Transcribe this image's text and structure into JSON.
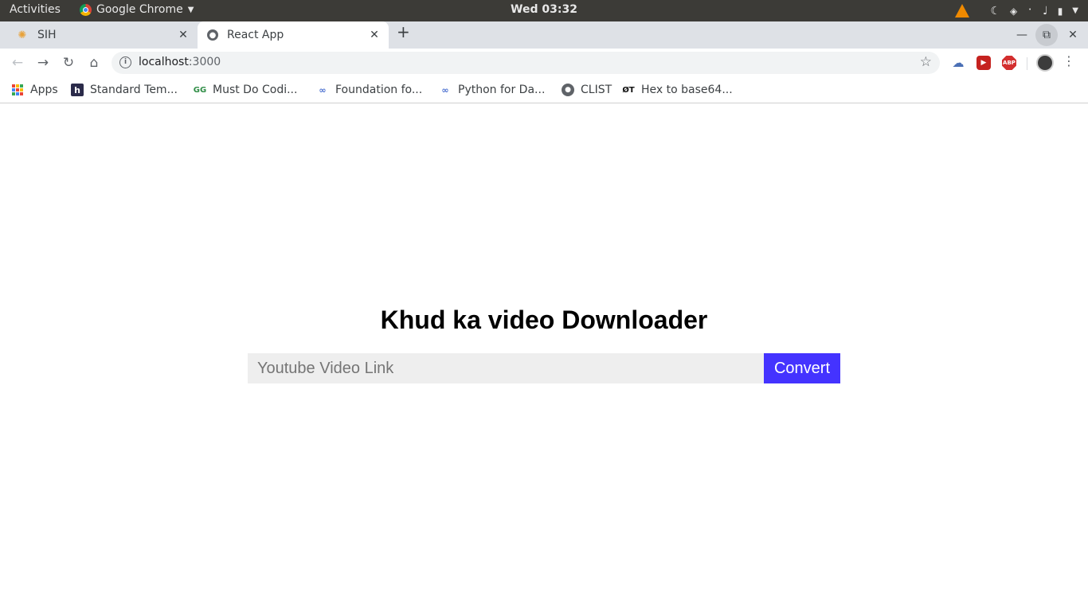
{
  "system_bar": {
    "activities": "Activities",
    "app_name": "Google Chrome",
    "clock": "Wed 03:32"
  },
  "tabs": [
    {
      "label": "SIH",
      "active": false
    },
    {
      "label": "React App",
      "active": true
    }
  ],
  "toolbar": {
    "url_host": "localhost",
    "url_port": ":3000"
  },
  "bookmarks": [
    {
      "label": "Apps",
      "icon": "apps-grid-icon"
    },
    {
      "label": "Standard Tem...",
      "icon": "h-icon"
    },
    {
      "label": "Must Do Codi...",
      "icon": "gfg-icon"
    },
    {
      "label": "Foundation fo...",
      "icon": "link-icon"
    },
    {
      "label": "Python for Da...",
      "icon": "link-icon"
    },
    {
      "label": "CLIST",
      "icon": "globe-icon"
    },
    {
      "label": "Hex to base64...",
      "icon": "ot-icon"
    }
  ],
  "page": {
    "heading": "Khud ka video Downloader",
    "input_placeholder": "Youtube Video Link",
    "input_value": "",
    "convert_label": "Convert",
    "button_color": "#4433ff"
  }
}
